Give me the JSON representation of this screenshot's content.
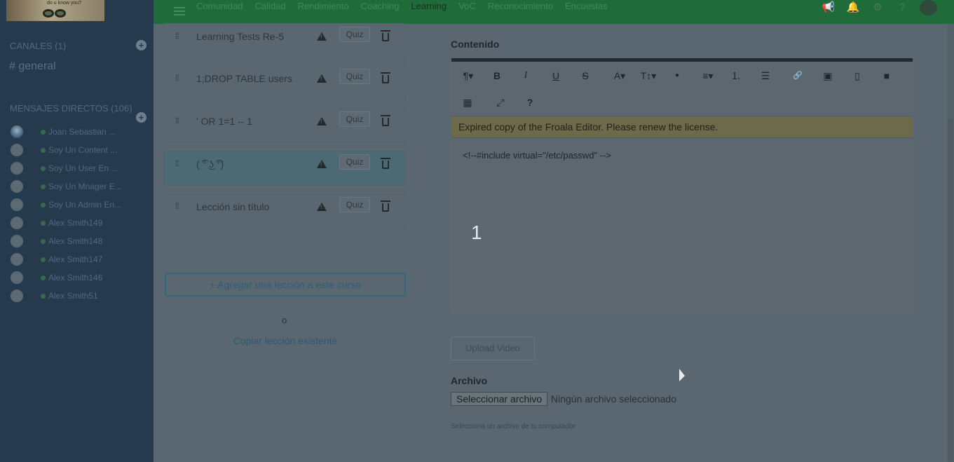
{
  "topnav": {
    "items": [
      "Comunidad",
      "Calidad",
      "Rendimiento",
      "Coaching",
      "Learning",
      "VoC",
      "Reconocimiento",
      "Encuestas"
    ],
    "active": "Learning",
    "icons": [
      "megaphone-icon",
      "bell-icon",
      "gear-icon",
      "help-icon",
      "avatar"
    ]
  },
  "logo": {
    "tagline": "do u know you?"
  },
  "sidebar": {
    "channels_header": "CANALES (1)",
    "channels": [
      "# general"
    ],
    "dm_header": "MENSAJES DIRECTOS (106)",
    "dms": [
      {
        "name": "Joan Sebastian ...",
        "photo": true
      },
      {
        "name": "Soy Un Content ..."
      },
      {
        "name": "Soy Un User En ..."
      },
      {
        "name": "Soy Un Mnager E..."
      },
      {
        "name": "Soy Un Admin En..."
      },
      {
        "name": "Alex Smith149"
      },
      {
        "name": "Alex Smith148"
      },
      {
        "name": "Alex Smith147"
      },
      {
        "name": "Alex Smith146"
      },
      {
        "name": "Alex Smith51"
      }
    ]
  },
  "lessons": {
    "items": [
      {
        "title": "Learning Tests Re-5",
        "quiz": "Quiz"
      },
      {
        "title": "1;DROP TABLE users",
        "quiz": "Quiz"
      },
      {
        "title": "' OR 1=1 -- 1",
        "quiz": "Quiz"
      },
      {
        "title": "( ͡° ͜ʖ ͡°)",
        "quiz": "Quiz",
        "selected": true
      },
      {
        "title": "Lección sin título",
        "quiz": "Quiz"
      }
    ],
    "add_button": "+ Agregar una lección a este curso",
    "or_text": "o",
    "copy_link": "Copiar lección existente"
  },
  "content": {
    "label": "Contenido",
    "toolbar_icons": [
      "paragraph-icon",
      "bold-icon",
      "italic-icon",
      "underline-icon",
      "strikethrough-icon",
      "font-family-icon",
      "font-size-icon",
      "color-icon",
      "align-icon",
      "ordered-list-icon",
      "unordered-list-icon",
      "link-icon",
      "image-icon",
      "file-icon",
      "video-icon",
      "table-icon",
      "fullscreen-icon",
      "help-icon"
    ],
    "toolbar_glyphs": {
      "paragraph": "¶▾",
      "bold": "B",
      "italic": "I",
      "underline": "U",
      "strike": "S",
      "font": "A▾",
      "size": "T↕▾",
      "color": "●",
      "align": "≡▾",
      "ol": "⒈",
      "ul": "☰",
      "link": "🔗",
      "image": "▣",
      "file": "▯",
      "video": "■",
      "table": "▦",
      "fullscreen": "⤢",
      "help": "?"
    },
    "license_banner": "Expired copy of the Froala Editor. Please renew the license.",
    "body_text": "<!--#include virtual=\"/etc/passwd\" -->",
    "overlay_number": "1"
  },
  "upload": {
    "video_button": "Upload Video",
    "file_label": "Archivo",
    "file_button": "Seleccionar archivo",
    "file_status": "Ningún archivo seleccionado",
    "file_help": "Selecciona un archivo de tu computador"
  }
}
